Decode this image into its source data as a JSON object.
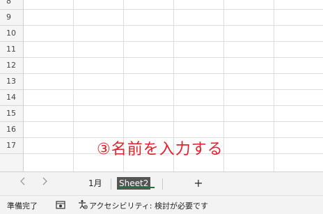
{
  "rows": [
    "8",
    "9",
    "10",
    "11",
    "12",
    "13",
    "14",
    "15",
    "16",
    "17"
  ],
  "annotation": "③名前を入力する",
  "tabs": {
    "prev_icon": "chevron-left-icon",
    "next_icon": "chevron-right-icon",
    "sheet1": "1月",
    "sheet2": "Sheet2",
    "add": "+"
  },
  "status": {
    "ready": "準備完了",
    "macro_icon": "macro-record-icon",
    "accessibility_icon": "accessibility-icon",
    "accessibility": "アクセシビリティ: 検討が必要です"
  },
  "colors": {
    "annotation": "#e3202a",
    "active_tab_bg": "#555555",
    "active_tab_underline": "#1e7145"
  }
}
